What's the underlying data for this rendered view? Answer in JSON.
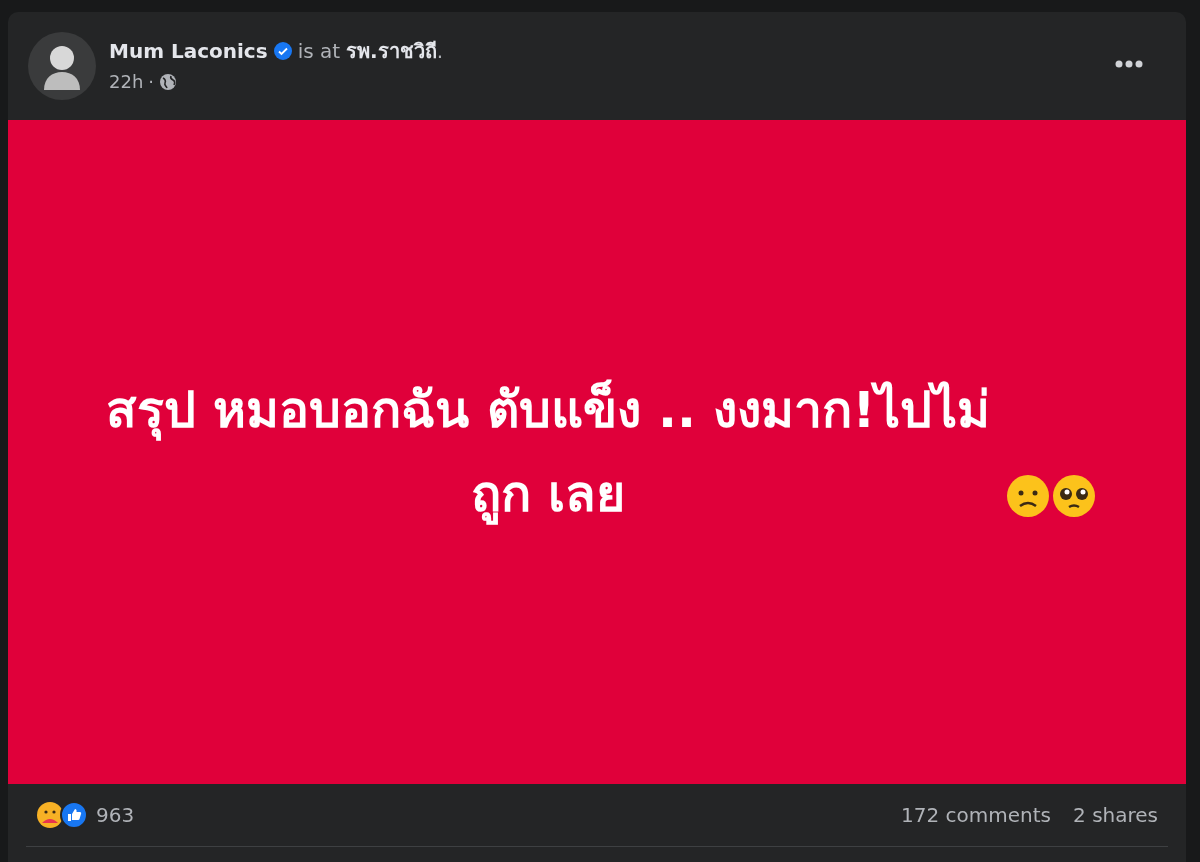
{
  "post": {
    "author": "Mum Laconics",
    "verified": true,
    "location_prefix": "is at",
    "location": "รพ.ราชวิถี",
    "location_suffix": ".",
    "time": "22h",
    "separator": "·"
  },
  "content": {
    "text": "สรุป หมอบอกฉัน ตับแข็ง .. งงมาก!ไปไม่ถูก เลย"
  },
  "stats": {
    "reactions_count": "963",
    "comments": "172 comments",
    "shares": "2 shares"
  }
}
